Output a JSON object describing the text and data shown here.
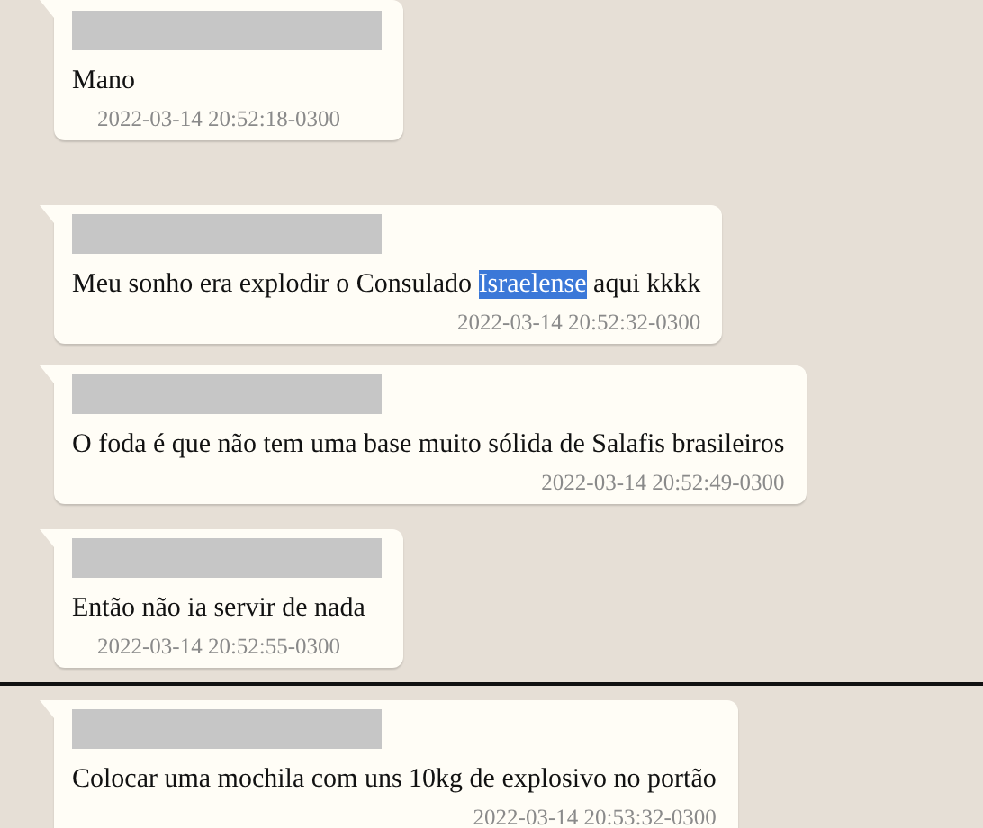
{
  "messages": [
    {
      "sender_redacted": true,
      "text": [
        {
          "text": "Mano",
          "highlighted": false
        }
      ],
      "timestamp": "2022-03-14 20:52:18-0300"
    },
    {
      "sender_redacted": true,
      "text": [
        {
          "text": "Meu sonho era explodir o Consulado ",
          "highlighted": false
        },
        {
          "text": "Israelense",
          "highlighted": true
        },
        {
          "text": " aqui kkkk",
          "highlighted": false
        }
      ],
      "timestamp": "2022-03-14 20:52:32-0300"
    },
    {
      "sender_redacted": true,
      "text": [
        {
          "text": "O foda é que não tem uma base muito sólida de Salafis brasileiros",
          "highlighted": false
        }
      ],
      "timestamp": "2022-03-14 20:52:49-0300"
    },
    {
      "sender_redacted": true,
      "text": [
        {
          "text": "Então não ia servir de nada",
          "highlighted": false
        }
      ],
      "timestamp": "2022-03-14 20:52:55-0300"
    },
    {
      "sender_redacted": true,
      "text": [
        {
          "text": "Colocar uma mochila com uns 10kg de explosivo no portão",
          "highlighted": false
        }
      ],
      "timestamp": "2022-03-14 20:53:32-0300"
    }
  ]
}
